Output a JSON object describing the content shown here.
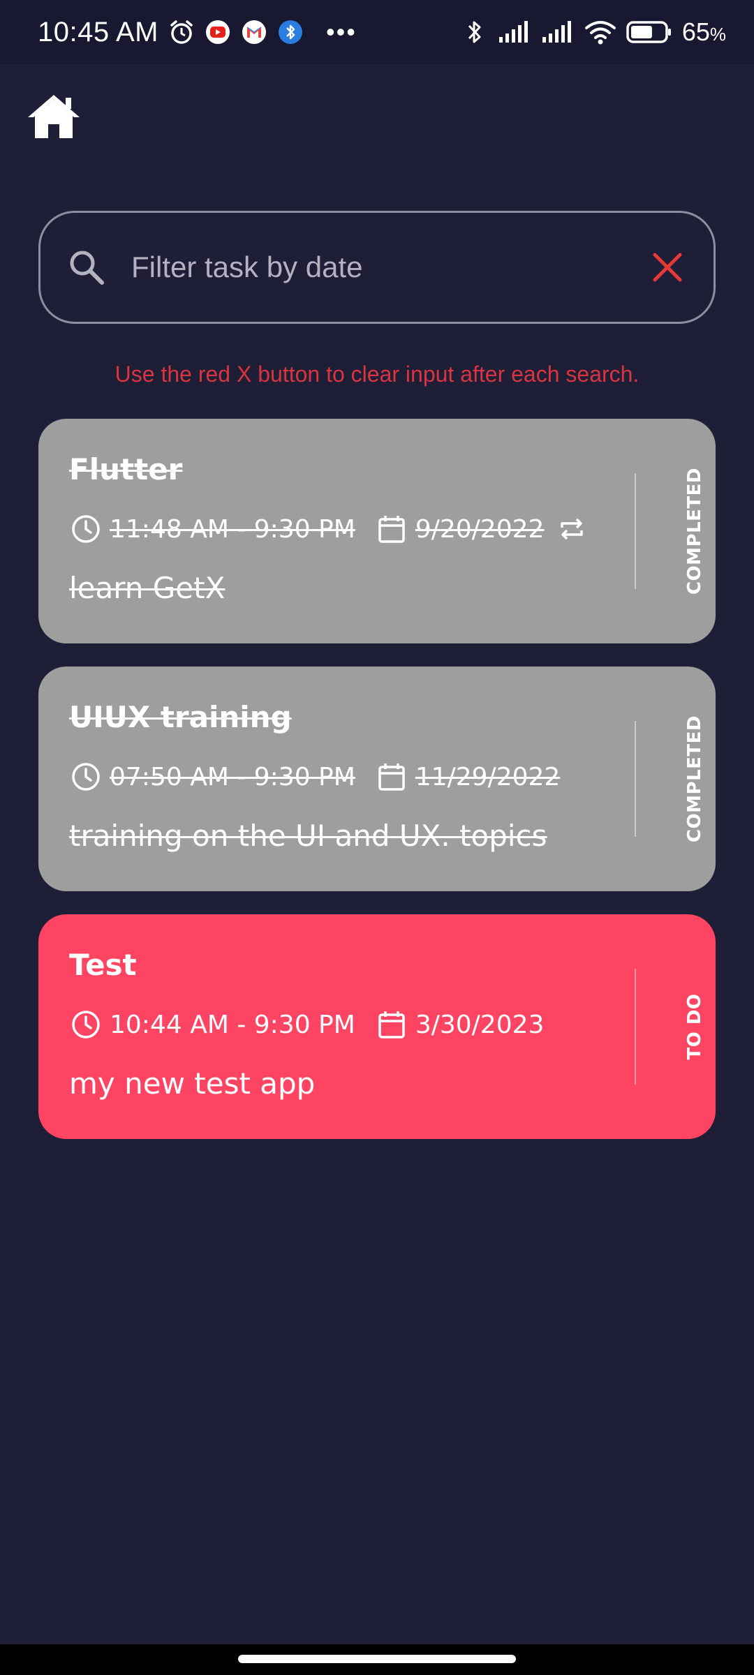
{
  "status_bar": {
    "time": "10:45 AM",
    "notification_icons": [
      "alarm-icon",
      "youtube-icon",
      "gmail-icon",
      "bluetooth-app-icon"
    ],
    "overflow": "•••",
    "battery_percent": "65",
    "battery_unit": "%",
    "battery_level": 0.65
  },
  "header": {
    "home_icon": "home-icon"
  },
  "search": {
    "placeholder": "Filter task by date",
    "value": "",
    "clear_color": "#e53935"
  },
  "hint": "Use the red X button to clear input after each search.",
  "tasks": [
    {
      "title": "Flutter",
      "time": "11:48 AM - 9:30 PM",
      "date": "9/20/2022",
      "repeat": true,
      "note": "learn GetX",
      "status": "COMPLETED",
      "color": "#9e9e9e"
    },
    {
      "title": "UIUX training",
      "time": "07:50 AM - 9:30 PM",
      "date": "11/29/2022",
      "repeat": false,
      "note": "training on the UI and UX. topics",
      "status": "COMPLETED",
      "color": "#9e9e9e"
    },
    {
      "title": "Test",
      "time": "10:44 AM - 9:30 PM",
      "date": "3/30/2023",
      "repeat": false,
      "note": "my new test app",
      "status": "TO DO",
      "color": "#fe4463"
    }
  ],
  "colors": {
    "background": "#1e1e36",
    "status_bar": "#181830",
    "hint_red": "#d9343f",
    "completed_card": "#9e9e9e",
    "todo_card": "#fe4463"
  }
}
